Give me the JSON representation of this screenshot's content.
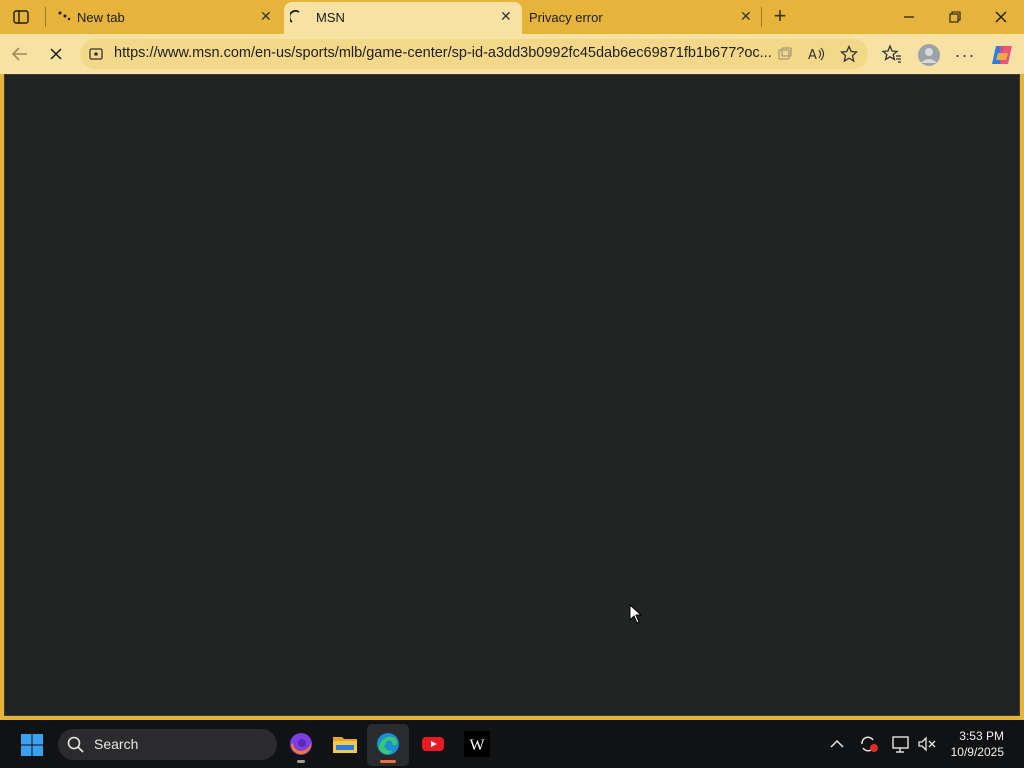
{
  "browser": {
    "tabs": [
      {
        "title": "New tab"
      },
      {
        "title": "MSN"
      },
      {
        "title": "Privacy error"
      }
    ],
    "url": "https://www.msn.com/en-us/sports/mlb/game-center/sp-id-a3dd3b0992fc45dab6ec69871fb1b677?oc...",
    "colors": {
      "frame": "#e6b43a",
      "toolbar": "#f7e2a4",
      "content": "#222424"
    }
  },
  "taskbar": {
    "search_label": "Search",
    "time": "3:53 PM",
    "date": "10/9/2025"
  }
}
